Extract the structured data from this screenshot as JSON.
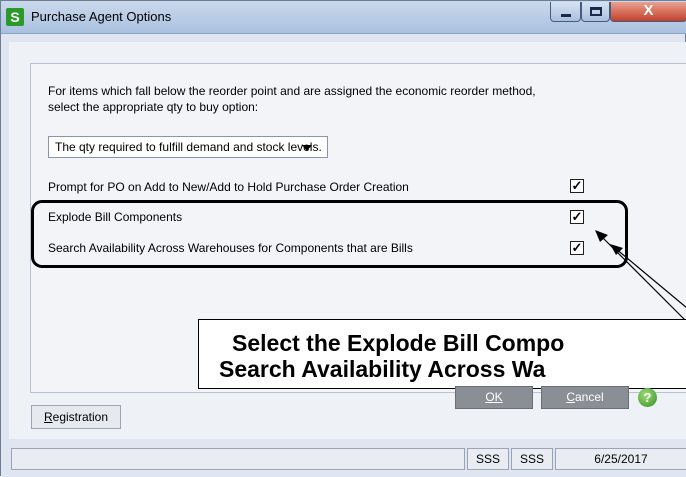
{
  "window": {
    "title": "Purchase Agent Options",
    "app_icon_letter": "S",
    "close_glyph": "X"
  },
  "options": {
    "intro_line1": "For items which fall below the reorder point and are assigned the economic reorder method,",
    "intro_line2": "select the appropriate qty to buy option:",
    "qty_option_selected": "The qty required to fulfill demand and stock levels.",
    "prompt_po_label": "Prompt for PO on Add to New/Add to Hold Purchase Order Creation",
    "prompt_po_checked": true,
    "explode_bill_label": "Explode Bill Components",
    "explode_bill_checked": true,
    "search_avail_label": "Search Availability Across Warehouses for Components that are Bills",
    "search_avail_checked": true
  },
  "callout": {
    "line1": "Select the Explode Bill Compo",
    "line2": "Search Availability Across Wa"
  },
  "buttons": {
    "registration": "Registration",
    "ok": "OK",
    "cancel": "Cancel"
  },
  "status": {
    "cell1": "SSS",
    "cell2": "SSS",
    "date": "6/25/2017"
  },
  "colors": {
    "app_icon": "#2c9a2a",
    "title_bar": "#bcd0ea",
    "close_button": "#c2412c",
    "help_icon": "#2f8e1e"
  }
}
